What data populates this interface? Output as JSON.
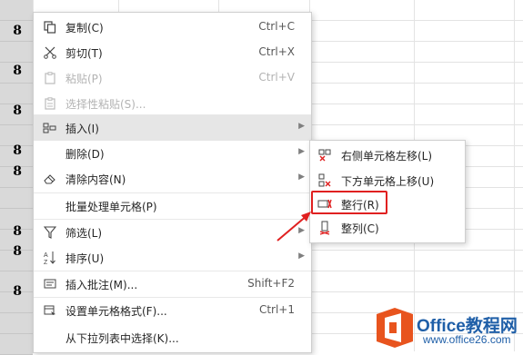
{
  "sheet": {
    "row_values": [
      "8",
      "8",
      "8",
      "8",
      "8",
      "8",
      "8",
      "8"
    ]
  },
  "menu": {
    "items": [
      {
        "label": "复制(C)",
        "shortcut": "Ctrl+C",
        "icon": "copy-icon"
      },
      {
        "label": "剪切(T)",
        "shortcut": "Ctrl+X",
        "icon": "cut-icon"
      },
      {
        "label": "粘贴(P)",
        "shortcut": "Ctrl+V",
        "icon": "paste-icon"
      },
      {
        "label": "选择性粘贴(S)...",
        "shortcut": "",
        "icon": "paste-special-icon"
      },
      {
        "label": "插入(I)",
        "shortcut": "",
        "icon": "insert-icon"
      },
      {
        "label": "删除(D)",
        "shortcut": "",
        "icon": ""
      },
      {
        "label": "清除内容(N)",
        "shortcut": "",
        "icon": "eraser-icon"
      },
      {
        "label": "批量处理单元格(P)",
        "shortcut": "",
        "icon": ""
      },
      {
        "label": "筛选(L)",
        "shortcut": "",
        "icon": "filter-icon"
      },
      {
        "label": "排序(U)",
        "shortcut": "",
        "icon": "sort-icon"
      },
      {
        "label": "插入批注(M)...",
        "shortcut": "Shift+F2",
        "icon": "comment-icon"
      },
      {
        "label": "设置单元格格式(F)...",
        "shortcut": "Ctrl+1",
        "icon": "format-cells-icon"
      },
      {
        "label": "从下拉列表中选择(K)...",
        "shortcut": "",
        "icon": ""
      }
    ]
  },
  "submenu": {
    "items": [
      {
        "label": "右侧单元格左移(L)",
        "icon": "shift-left-icon"
      },
      {
        "label": "下方单元格上移(U)",
        "icon": "shift-up-icon"
      },
      {
        "label": "整行(R)",
        "icon": "entire-row-icon"
      },
      {
        "label": "整列(C)",
        "icon": "entire-column-icon"
      }
    ]
  },
  "watermark": {
    "brand": "Office教程网",
    "url": "www.office26.com"
  },
  "colors": {
    "accent_red": "#e02020",
    "brand_orange": "#e8541e",
    "brand_blue": "#1f5fa8"
  }
}
